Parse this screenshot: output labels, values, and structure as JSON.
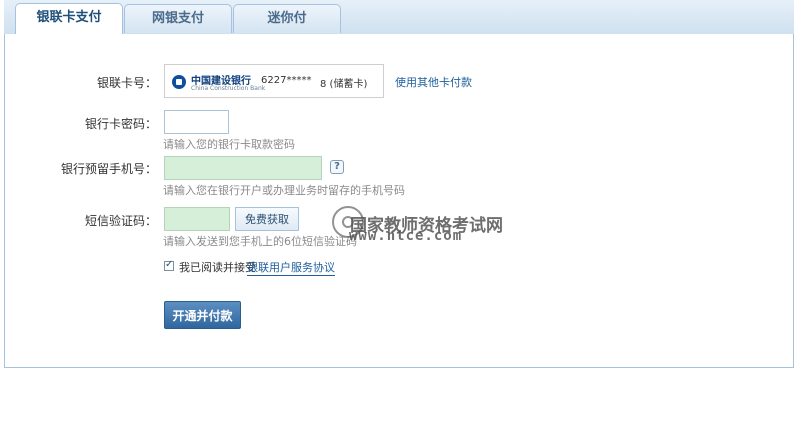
{
  "tabs": [
    {
      "label": "银联卡支付",
      "active": true
    },
    {
      "label": "网银支付",
      "active": false
    },
    {
      "label": "迷你付",
      "active": false
    }
  ],
  "form": {
    "card_label": "银联卡号：",
    "bank_name_cn": "中国建设银行",
    "bank_name_en": "China Construction Bank",
    "card_number": "6227*****",
    "card_tail": "8 (储蓄卡)",
    "other_card_link": "使用其他卡付款",
    "password_label": "银行卡密码：",
    "password_hint": "请输入您的银行卡取款密码",
    "phone_label": "银行预留手机号：",
    "phone_help": "?",
    "phone_hint": "请输入您在银行开户或办理业务时留存的手机号码",
    "sms_label": "短信验证码：",
    "sms_button": "免费获取",
    "sms_hint": "请输入发送到您手机上的6位短信验证码",
    "agree_text": "我已阅读并接受",
    "agree_link": "银联用户服务协议",
    "agree_checked": true,
    "submit_label": "开通并付款"
  },
  "watermark": {
    "cn": "国家教师资格考试网",
    "url": "www.ntce.com"
  },
  "colors": {
    "accent": "#2f679e",
    "tab_border": "#a6c2dc",
    "input_green": "#d6efd9",
    "link": "#1f5f9c"
  }
}
